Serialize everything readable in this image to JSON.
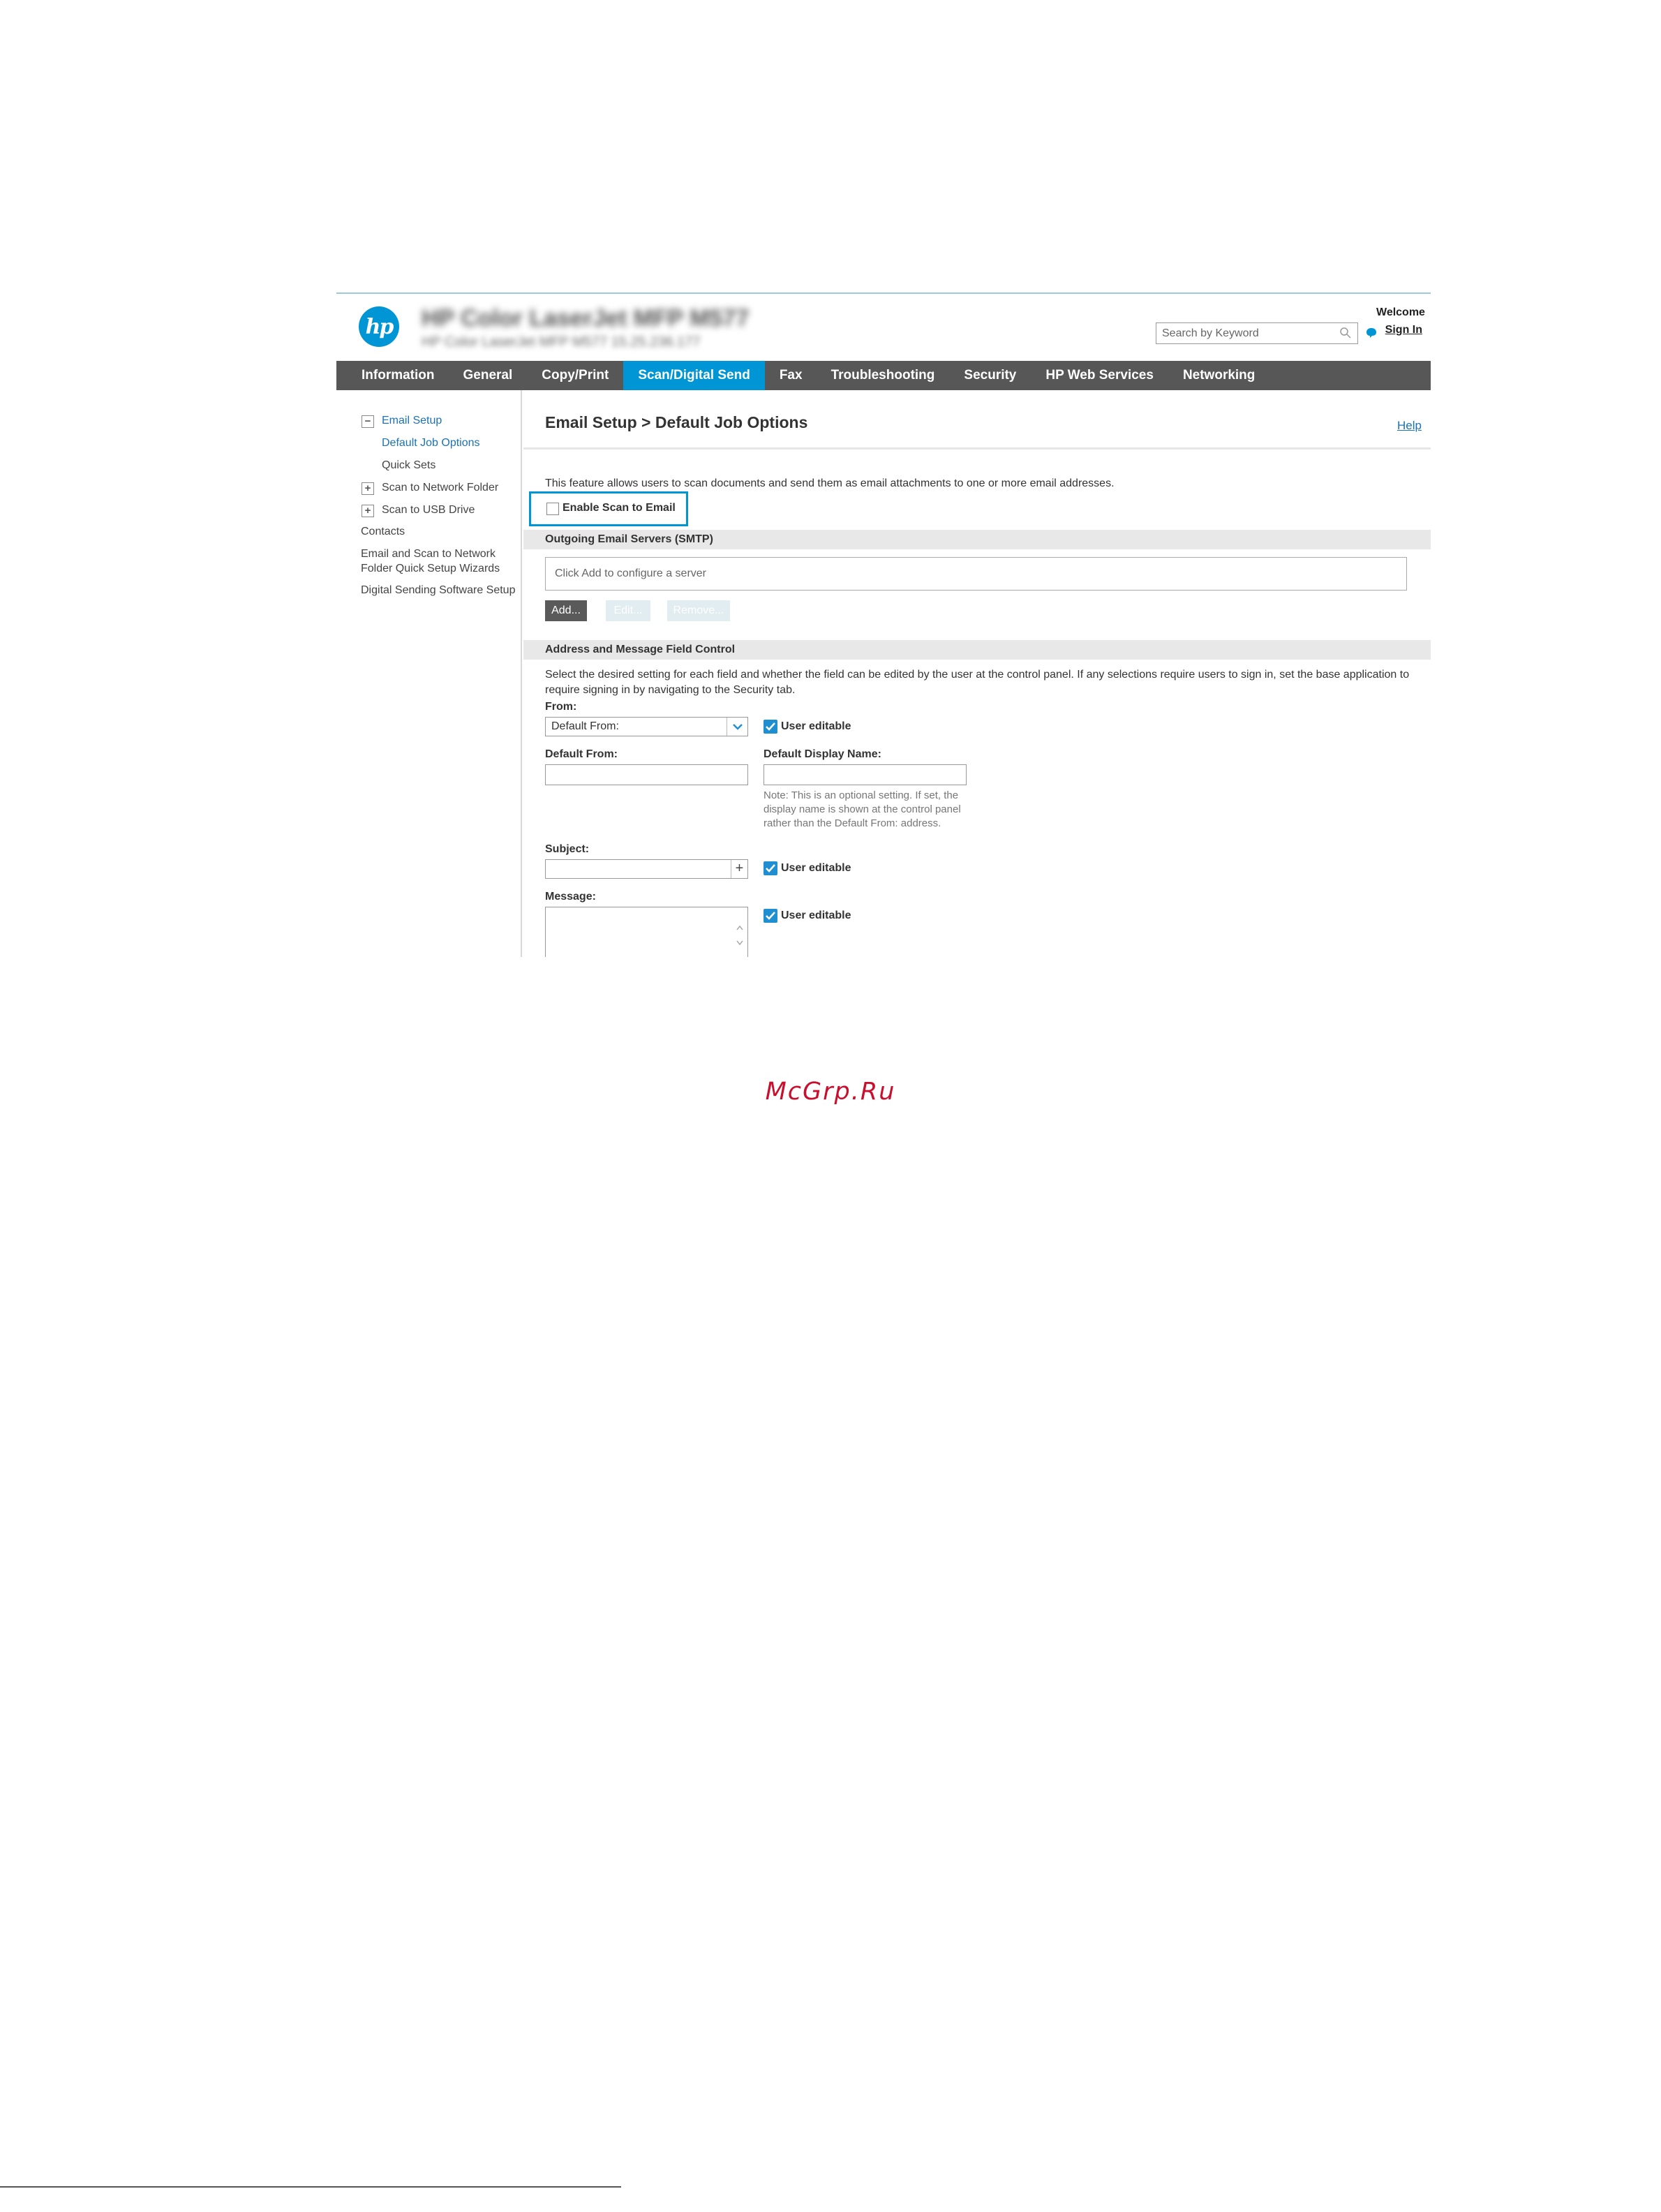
{
  "header": {
    "product_title": "HP Color LaserJet MFP M577",
    "product_subtitle": "HP Color LaserJet MFP M577   15.25.236.177",
    "logo_text": "hp",
    "search_placeholder": "Search by Keyword",
    "welcome": "Welcome",
    "sign_in": "Sign In"
  },
  "nav": {
    "tabs": [
      {
        "label": "Information"
      },
      {
        "label": "General"
      },
      {
        "label": "Copy/Print"
      },
      {
        "label": "Scan/Digital Send",
        "active": true
      },
      {
        "label": "Fax"
      },
      {
        "label": "Troubleshooting"
      },
      {
        "label": "Security"
      },
      {
        "label": "HP Web Services"
      },
      {
        "label": "Networking"
      }
    ]
  },
  "sidebar": {
    "items": [
      {
        "label": "Email Setup",
        "expander": "−"
      },
      {
        "label": "Default Job Options"
      },
      {
        "label": "Quick Sets"
      },
      {
        "label": "Scan to Network Folder",
        "expander": "+"
      },
      {
        "label": "Scan to USB Drive",
        "expander": "+"
      },
      {
        "label": "Contacts"
      },
      {
        "label": "Email and Scan to Network"
      },
      {
        "label": "Folder Quick Setup Wizards"
      },
      {
        "label": "Digital Sending Software Setup"
      }
    ]
  },
  "main": {
    "title": "Email Setup > Default Job Options",
    "help": "Help",
    "intro": "This feature allows users to scan documents and send them as email attachments to one or more email addresses.",
    "enable_label": "Enable Scan to Email",
    "smtp_heading": "Outgoing Email Servers (SMTP)",
    "server_placeholder": "Click Add to configure a server",
    "buttons": {
      "add": "Add...",
      "edit": "Edit...",
      "remove": "Remove..."
    },
    "address_heading": "Address and Message Field Control",
    "address_desc": "Select the desired setting for each field and whether the field can be edited by the user at the control panel. If any selections require users to sign in, set the base application to require signing in by navigating to the Security tab.",
    "from_label": "From:",
    "from_value": "Default From:",
    "user_editable": "User editable",
    "default_from_label": "Default From:",
    "default_display_label": "Default Display Name:",
    "note": "Note: This is an optional setting. If set, the display name is shown at the control panel rather than the Default From: address.",
    "subject_label": "Subject:",
    "message_label": "Message:"
  },
  "watermark": "McGrp.Ru",
  "colors": {
    "accent": "#0096d6",
    "nav_bg": "#575757",
    "link": "#1a73b8"
  }
}
